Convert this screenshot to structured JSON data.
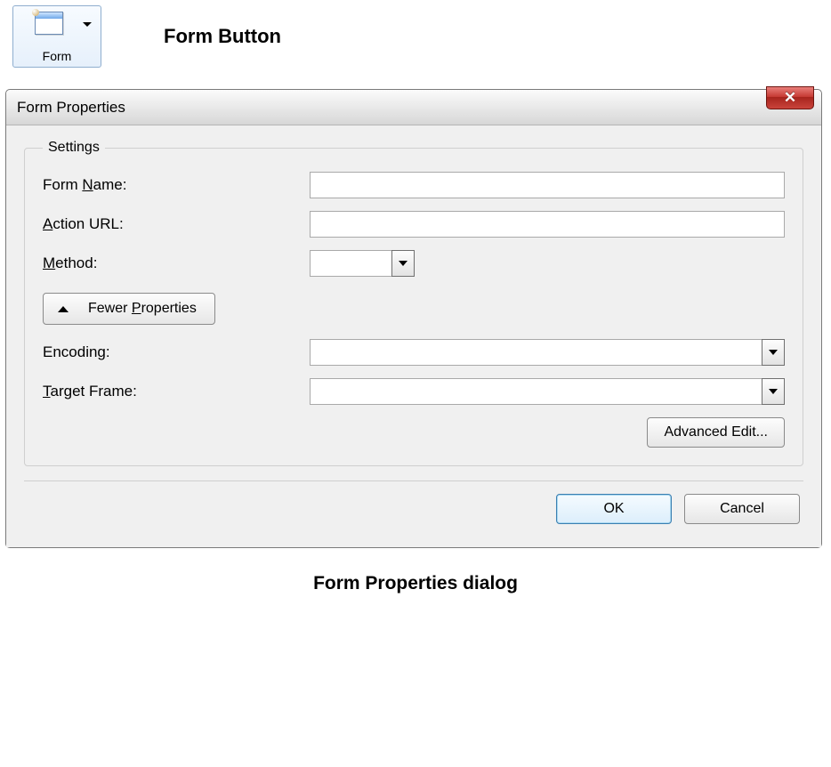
{
  "toolbar": {
    "form_button_label": "Form",
    "heading": "Form Button"
  },
  "dialog": {
    "title": "Form Properties",
    "close_glyph": "✕",
    "settings_legend": "Settings",
    "labels": {
      "form_name_pre": "Form ",
      "form_name_u": "N",
      "form_name_post": "ame:",
      "action_u": "A",
      "action_post": "ction URL:",
      "method_u": "M",
      "method_post": "ethod:",
      "encoding": "Encoding:",
      "target_u": "T",
      "target_post": "arget Frame:"
    },
    "values": {
      "form_name": "",
      "action_url": "",
      "method": "",
      "encoding": "",
      "target_frame": ""
    },
    "fewer_pre": "Fewer ",
    "fewer_u": "P",
    "fewer_post": "roperties",
    "advanced_label": "Advanced Edit...",
    "ok_label": "OK",
    "cancel_label": "Cancel"
  },
  "caption": "Form Properties dialog"
}
